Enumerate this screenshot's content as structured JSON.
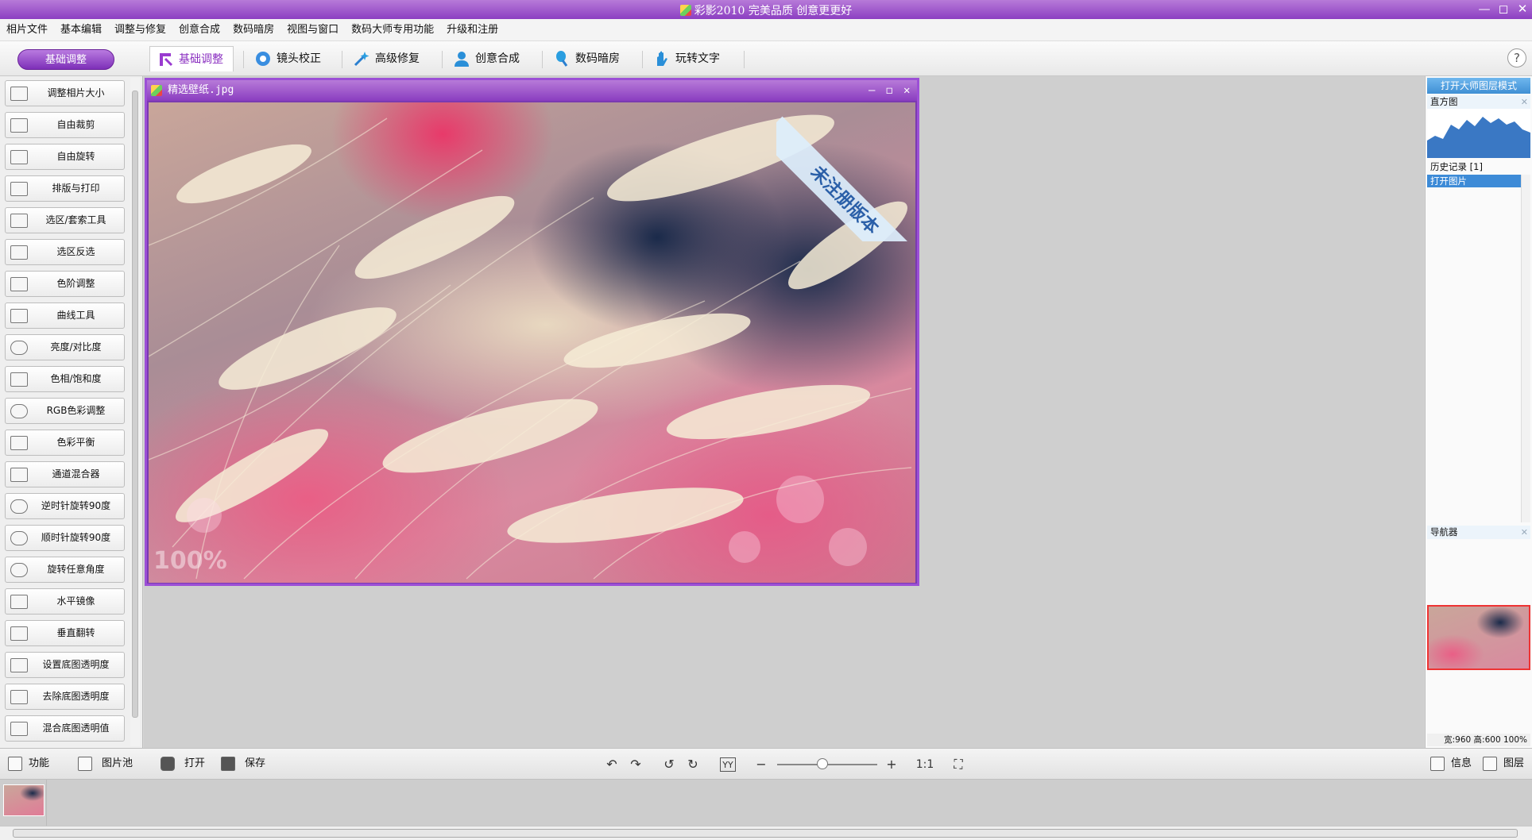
{
  "app": {
    "title": "彩影2010  完美品质  创意更更好"
  },
  "menu": [
    "相片文件",
    "基本编辑",
    "调整与修复",
    "创意合成",
    "数码暗房",
    "视图与窗口",
    "数码大师专用功能",
    "升级和注册"
  ],
  "toolbar": {
    "mode_button": "基础调整",
    "tabs": [
      "基础调整",
      "镜头校正",
      "高级修复",
      "创意合成",
      "数码暗房",
      "玩转文字"
    ],
    "help": "?"
  },
  "left_tools": [
    "调整相片大小",
    "自由裁剪",
    "自由旋转",
    "排版与打印",
    "选区/套索工具",
    "选区反选",
    "色阶调整",
    "曲线工具",
    "亮度/对比度",
    "色相/饱和度",
    "RGB色彩调整",
    "色彩平衡",
    "通道混合器",
    "逆时针旋转90度",
    "顺时针旋转90度",
    "旋转任意角度",
    "水平镜像",
    "垂直翻转",
    "设置底图透明度",
    "去除底图透明度",
    "混合底图透明值"
  ],
  "document": {
    "filename": "精选壁纸.jpg",
    "zoom_watermark": "100%",
    "unregistered_ribbon": "未注册版本"
  },
  "right_panel": {
    "master_button": "打开大师图层模式",
    "histogram_label": "直方图",
    "history_label": "历史记录 [1]",
    "history_items": [
      "打开图片"
    ],
    "navigator_label": "导航器",
    "image_info": "宽:960 高:600 100%"
  },
  "bottom_bar": {
    "func_tab": "功能",
    "pool_tab": "图片池",
    "open": "打开",
    "save": "保存",
    "zoom_actual": "1:1",
    "zoom_level": 0.45,
    "info_tab": "信息",
    "layer_tab": "图层"
  },
  "icons": {
    "close": "✕",
    "maximize": "◻",
    "minimize": "—",
    "undo": "↶",
    "redo": "↷",
    "rotate_left": "↺",
    "rotate_right": "↻",
    "zoom_out": "−",
    "zoom_in": "+",
    "fit": "⛶"
  },
  "colors": {
    "accent": "#8c3fc2",
    "selection_blue": "#3d8bd7"
  }
}
